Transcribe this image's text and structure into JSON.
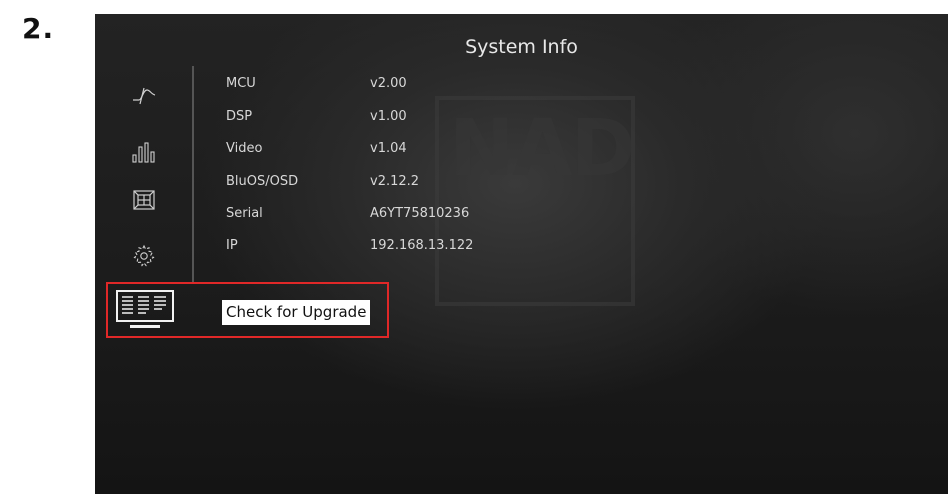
{
  "step": {
    "number": "2."
  },
  "screen": {
    "title": "System Info",
    "watermark": "NAD",
    "sidebar": [
      {
        "icon": "waveform-icon"
      },
      {
        "icon": "equalizer-icon"
      },
      {
        "icon": "speakers-icon"
      },
      {
        "icon": "settings-gear-icon"
      },
      {
        "icon": "system-info-icon",
        "selected": true
      }
    ],
    "info": [
      {
        "label": "MCU",
        "value": "v2.00"
      },
      {
        "label": "DSP",
        "value": "v1.00"
      },
      {
        "label": "Video",
        "value": "v1.04"
      },
      {
        "label": "BluOS/OSD",
        "value": "v2.12.2"
      },
      {
        "label": "Serial",
        "value": "A6YT75810236"
      },
      {
        "label": "IP",
        "value": "192.168.13.122"
      }
    ],
    "upgrade_button": "Check for Upgrade",
    "colors": {
      "highlight": "#e02828",
      "background": "#1e1e1e",
      "text": "#d8d8d8"
    }
  }
}
